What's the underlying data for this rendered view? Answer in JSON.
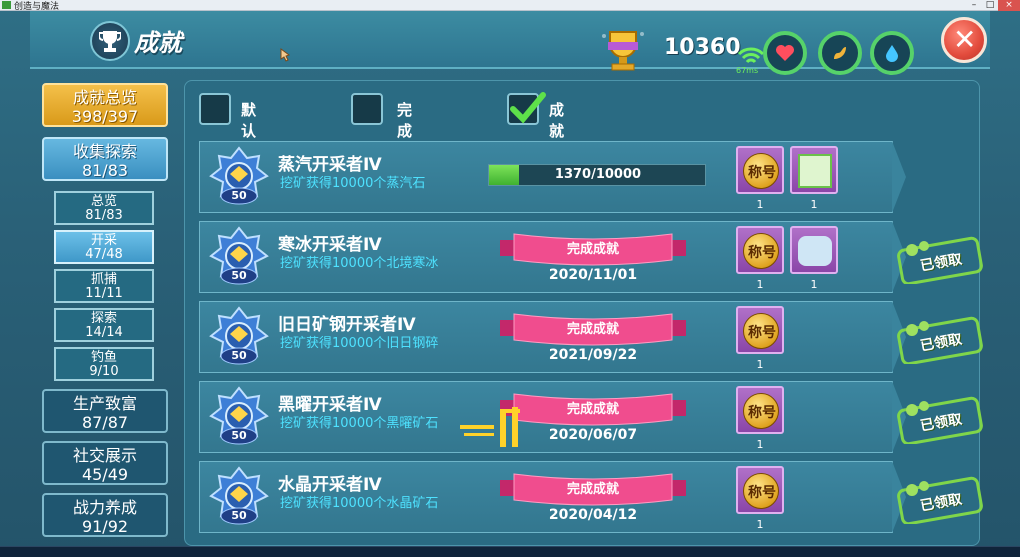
{
  "window": {
    "title": "创造与魔法"
  },
  "header": {
    "title": "成就",
    "score": "10360",
    "ping": "67ms"
  },
  "colors": {
    "accent": "#56d26a",
    "close": "#e24b3c",
    "desc": "#4ee2ff",
    "gold": "#f4c04a"
  },
  "nav": {
    "total": {
      "label": "成就总览",
      "count": "398/397"
    },
    "collect": {
      "label": "收集探索",
      "count": "81/83"
    },
    "subs": [
      {
        "label": "总览",
        "count": "81/83"
      },
      {
        "label": "开采",
        "count": "47/48"
      },
      {
        "label": "抓捕",
        "count": "11/11"
      },
      {
        "label": "探索",
        "count": "14/14"
      },
      {
        "label": "钓鱼",
        "count": "9/10"
      }
    ],
    "groups": [
      {
        "label": "生产致富",
        "count": "87/87"
      },
      {
        "label": "社交展示",
        "count": "45/49"
      },
      {
        "label": "战力养成",
        "count": "91/92"
      }
    ]
  },
  "sort": {
    "options": [
      {
        "label": "默认排序",
        "checked": false
      },
      {
        "label": "完成度排序",
        "checked": false
      },
      {
        "label": "成就点排序",
        "checked": true
      }
    ]
  },
  "achievements": [
    {
      "name": "蒸汽开采者Ⅳ",
      "desc": "挖矿获得10000个蒸汽石",
      "points": "50",
      "progress_text": "1370/10000",
      "progress": 0.137,
      "rewards": [
        {
          "label": "称号",
          "count": "1"
        },
        {
          "icon": "flag-icon",
          "count": "1"
        }
      ]
    },
    {
      "name": "寒冰开采者Ⅳ",
      "desc": "挖矿获得10000个北境寒冰",
      "points": "50",
      "done_label": "完成成就",
      "date": "2020/11/01",
      "claimed": "已领取",
      "rewards": [
        {
          "label": "称号",
          "count": "1"
        },
        {
          "icon": "beast-icon",
          "count": "1"
        }
      ]
    },
    {
      "name": "旧日矿钢开采者Ⅳ",
      "desc": "挖矿获得10000个旧日钢碎",
      "points": "50",
      "done_label": "完成成就",
      "date": "2021/09/22",
      "claimed": "已领取",
      "rewards": [
        {
          "label": "称号",
          "count": "1"
        }
      ]
    },
    {
      "name": "黑曜开采者Ⅳ",
      "desc": "挖矿获得10000个黑曜矿石",
      "points": "50",
      "done_label": "完成成就",
      "date": "2020/06/07",
      "claimed": "已领取",
      "rewards": [
        {
          "label": "称号",
          "count": "1"
        }
      ]
    },
    {
      "name": "水晶开采者Ⅳ",
      "desc": "挖矿获得10000个水晶矿石",
      "points": "50",
      "done_label": "完成成就",
      "date": "2020/04/12",
      "claimed": "已领取",
      "rewards": [
        {
          "label": "称号",
          "count": "1"
        }
      ]
    }
  ]
}
